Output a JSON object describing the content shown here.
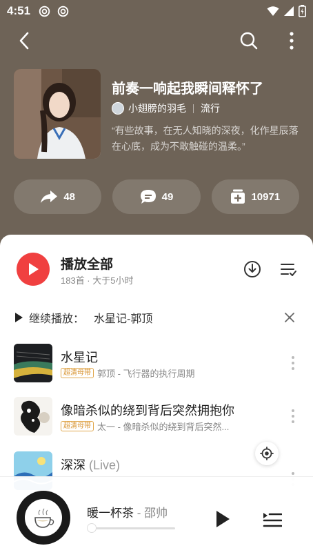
{
  "status_bar": {
    "time": "4:51"
  },
  "playlist": {
    "title": "前奏一响起我瞬间释怀了",
    "creator": "小翅膀的羽毛",
    "genre": "流行",
    "description": "“有些故事，在无人知晓的深夜，化作星辰落在心底，成为不敢触碰的温柔。”"
  },
  "actions": {
    "share_count": "48",
    "comment_count": "49",
    "collect_count": "10971"
  },
  "play_all": {
    "label": "播放全部",
    "summary": "183首 · 大于5小时"
  },
  "continue_play": {
    "label": "继续播放：",
    "song": "水星记-郭顶"
  },
  "tracks": [
    {
      "title": "水星记",
      "live": "",
      "badge": "超清母带",
      "meta": "郭顶 - 飞行器的执行周期"
    },
    {
      "title": "像暗杀似的绕到背后突然拥抱你",
      "live": "",
      "badge": "超清母带",
      "meta": "太一 - 像暗杀似的绕到背后突然..."
    },
    {
      "title": "深深",
      "live": "(Live)",
      "badge": "",
      "meta": ""
    }
  ],
  "now_playing": {
    "title": "暖一杯茶",
    "artist": " - 邵帅",
    "progress": 0.0
  },
  "colors": {
    "header_bg": "#6e6357",
    "accent_red": "#f04040",
    "badge_gold": "#d8932f"
  }
}
